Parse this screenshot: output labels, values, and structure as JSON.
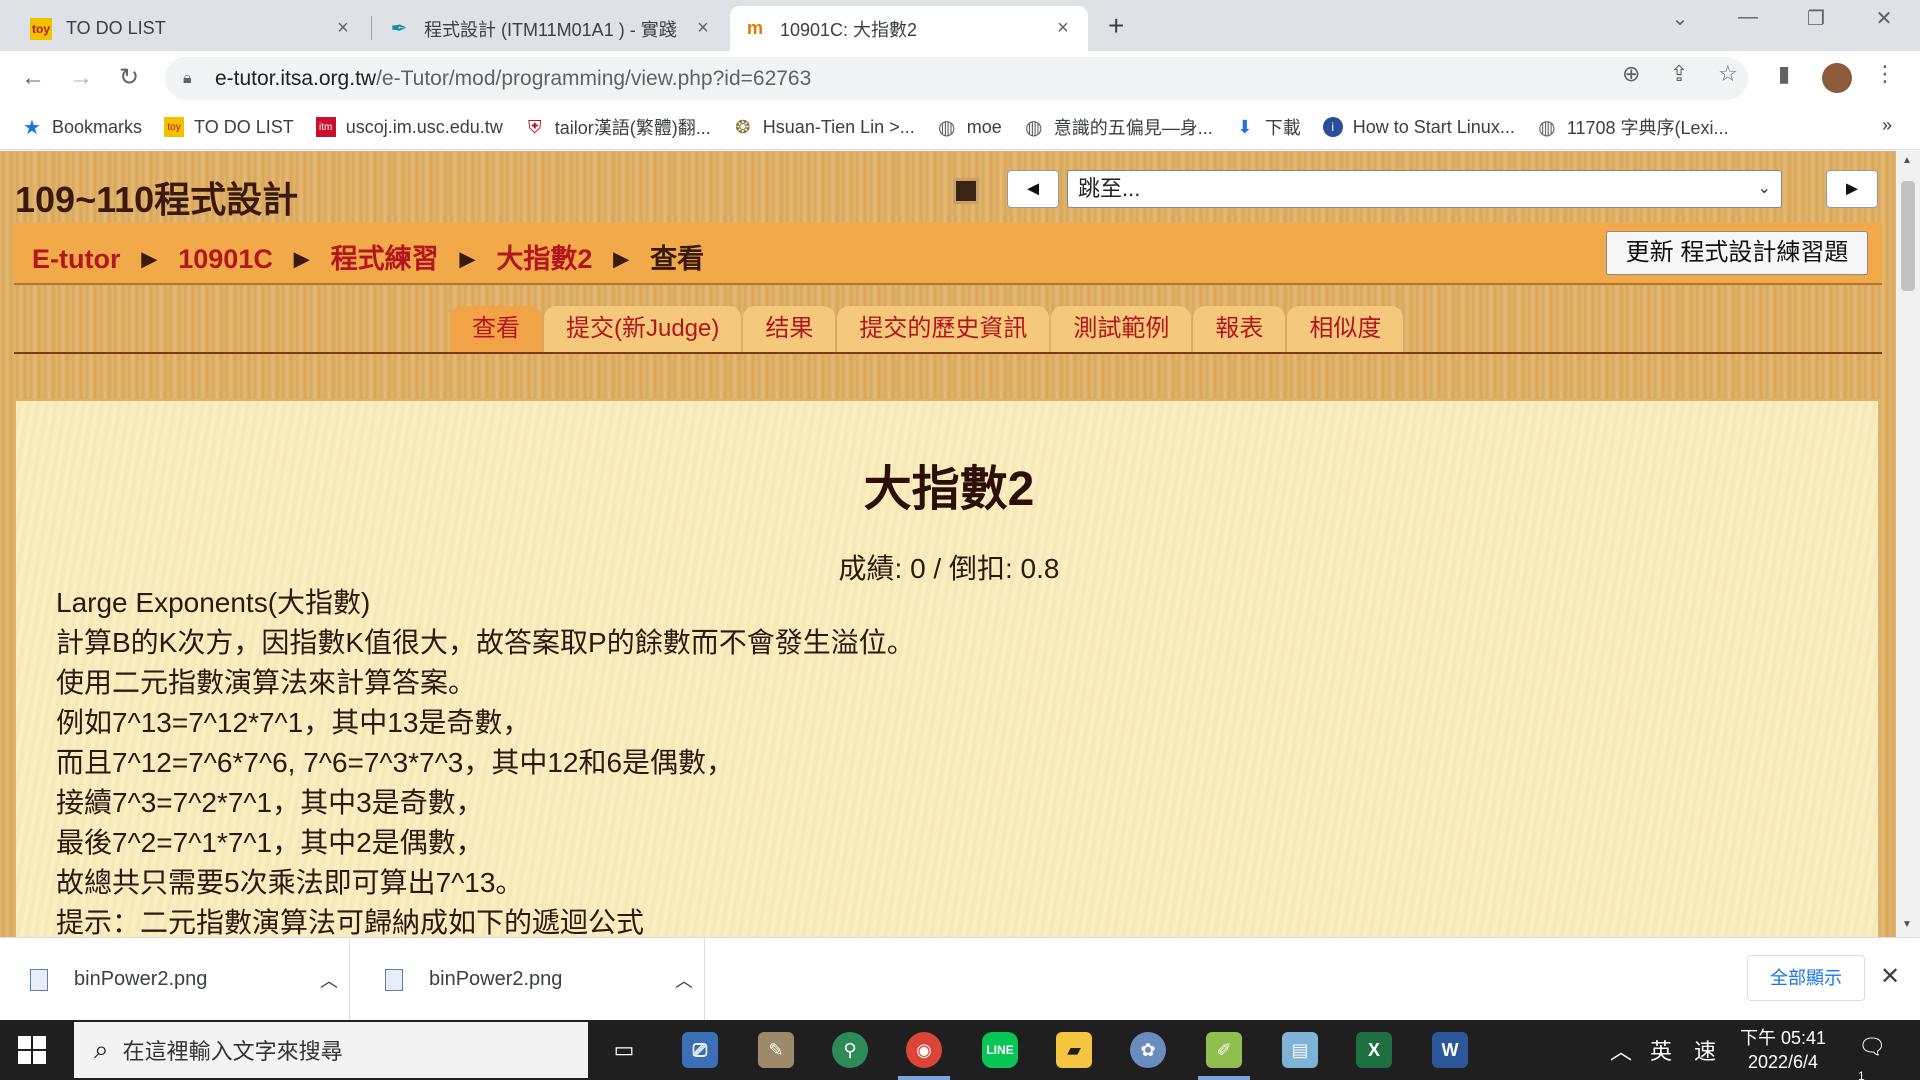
{
  "browser": {
    "tabs": [
      {
        "title": "TO DO LIST",
        "favicon": "todo-icon"
      },
      {
        "title": "程式設計 (ITM11M01A1 ) - 實踐",
        "favicon": "feather-icon"
      },
      {
        "title": "10901C: 大指數2",
        "favicon": "moodle-icon"
      }
    ],
    "new_tab": "+",
    "url_host": "e-tutor.itsa.org.tw",
    "url_path": "/e-Tutor/mod/programming/view.php?id=62763",
    "bookmarks": [
      {
        "label": "Bookmarks",
        "icon": "star-icon"
      },
      {
        "label": "TO DO LIST",
        "icon": "todo-icon"
      },
      {
        "label": "uscoj.im.usc.edu.tw",
        "icon": "itm-icon"
      },
      {
        "label": "tailor漢語(繁體)翻...",
        "icon": "shield-icon"
      },
      {
        "label": "Hsuan-Tien Lin >...",
        "icon": "seal-icon"
      },
      {
        "label": "moe",
        "icon": "globe-icon"
      },
      {
        "label": "意識的五偏見—身...",
        "icon": "globe-icon"
      },
      {
        "label": "下載",
        "icon": "download-icon"
      },
      {
        "label": "How to Start Linux...",
        "icon": "info-icon"
      },
      {
        "label": "11708 字典序(Lexi...",
        "icon": "globe-icon"
      }
    ],
    "bookmarks_more": "»"
  },
  "page": {
    "site_title": "109~110程式設計",
    "jump": {
      "prev": "◄",
      "select_value": "跳至...",
      "next": "►"
    },
    "breadcrumb": [
      "E-tutor",
      "10901C",
      "程式練習",
      "大指數2"
    ],
    "breadcrumb_current": "查看",
    "breadcrumb_sep": "►",
    "update_button": "更新 程式設計練習題",
    "tabs": [
      "查看",
      "提交(新Judge)",
      "结果",
      "提交的歷史資訊",
      "測試範例",
      "報表",
      "相似度"
    ],
    "active_tab": 0,
    "problem_title": "大指數2",
    "score": "成績: 0 / 倒扣: 0.8",
    "description": [
      "Large Exponents(大指數)",
      "計算B的K次方，因指數K值很大，故答案取P的餘數而不會發生溢位。",
      "使用二元指數演算法來計算答案。",
      "例如7^13=7^12*7^1，其中13是奇數，",
      "而且7^12=7^6*7^6, 7^6=7^3*7^3，其中12和6是偶數，",
      "接續7^3=7^2*7^1，其中3是奇數，",
      "最後7^2=7^1*7^1，其中2是偶數，",
      "故總共只需要5次乘法即可算出7^13。",
      "提示：二元指數演算法可歸納成如下的遞迴公式"
    ]
  },
  "downloads": {
    "items": [
      {
        "name": "binPower2.png"
      },
      {
        "name": "binPower2.png"
      }
    ],
    "show_all": "全部顯示",
    "close": "✕"
  },
  "taskbar": {
    "search_placeholder": "在這裡輸入文字來搜尋",
    "ime_lang": "英",
    "ime_mode": "速",
    "time": "下午 05:41",
    "date": "2022/6/4",
    "notification_count": "1"
  }
}
